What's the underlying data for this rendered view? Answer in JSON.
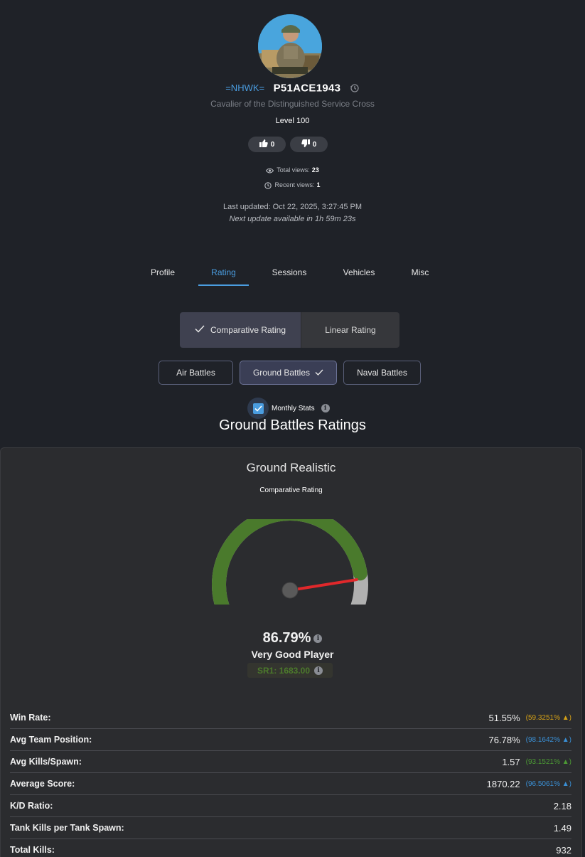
{
  "header": {
    "clan_tag": "=NHWK=",
    "nickname": "P51ACE1943",
    "title": "Cavalier of the Distinguished Service Cross",
    "level": "Level 100",
    "likes": "0",
    "dislikes": "0",
    "total_views_label": "Total views:",
    "total_views": "23",
    "recent_views_label": "Recent views:",
    "recent_views": "1",
    "last_updated": "Last updated: Oct 22, 2025, 3:27:45 PM",
    "next_update": "Next update available in 1h 59m 23s"
  },
  "tabs": [
    {
      "label": "Profile",
      "active": false
    },
    {
      "label": "Rating",
      "active": true
    },
    {
      "label": "Sessions",
      "active": false
    },
    {
      "label": "Vehicles",
      "active": false
    },
    {
      "label": "Misc",
      "active": false
    }
  ],
  "rating_type": {
    "comparative": "Comparative Rating",
    "linear": "Linear Rating",
    "selected": "comparative"
  },
  "battle_modes": {
    "air": "Air Battles",
    "ground": "Ground Battles",
    "naval": "Naval Battles",
    "selected": "ground"
  },
  "monthly_stats": {
    "label": "Monthly Stats",
    "checked": true
  },
  "section_title": "Ground Battles Ratings",
  "card": {
    "title": "Ground Realistic",
    "subtitle": "Comparative Rating",
    "gauge_value": 86.79,
    "percent": "86.79%",
    "verdict": "Very Good Player",
    "sr": "SR1: 1683.00"
  },
  "stats": [
    {
      "label": "Win Rate:",
      "value": "51.55%",
      "percentile": "(59.3251% ▲)",
      "color": "#d4a017"
    },
    {
      "label": "Avg Team Position:",
      "value": "76.78%",
      "percentile": "(98.1642% ▲)",
      "color": "#3a8fd4"
    },
    {
      "label": "Avg Kills/Spawn:",
      "value": "1.57",
      "percentile": "(93.1521% ▲)",
      "color": "#4c9a34"
    },
    {
      "label": "Average Score:",
      "value": "1870.22",
      "percentile": "(96.5061% ▲)",
      "color": "#3a8fd4"
    },
    {
      "label": "K/D Ratio:",
      "value": "2.18",
      "percentile": "",
      "color": ""
    },
    {
      "label": "Tank Kills per Tank Spawn:",
      "value": "1.49",
      "percentile": "",
      "color": ""
    },
    {
      "label": "Total Kills:",
      "value": "932",
      "percentile": "",
      "color": ""
    }
  ],
  "colors": {
    "accent": "#4a9de0",
    "gauge_fill": "#4a7a2c",
    "gauge_track": "#b0b0b0",
    "needle": "#e0282b",
    "sr_text": "#4c7a2c"
  },
  "icons": {
    "history": "history-icon",
    "like": "thumbs-up-icon",
    "dislike": "thumbs-down-icon",
    "eye": "eye-icon",
    "clock": "clock-icon",
    "check": "check-icon",
    "info": "info-icon"
  }
}
